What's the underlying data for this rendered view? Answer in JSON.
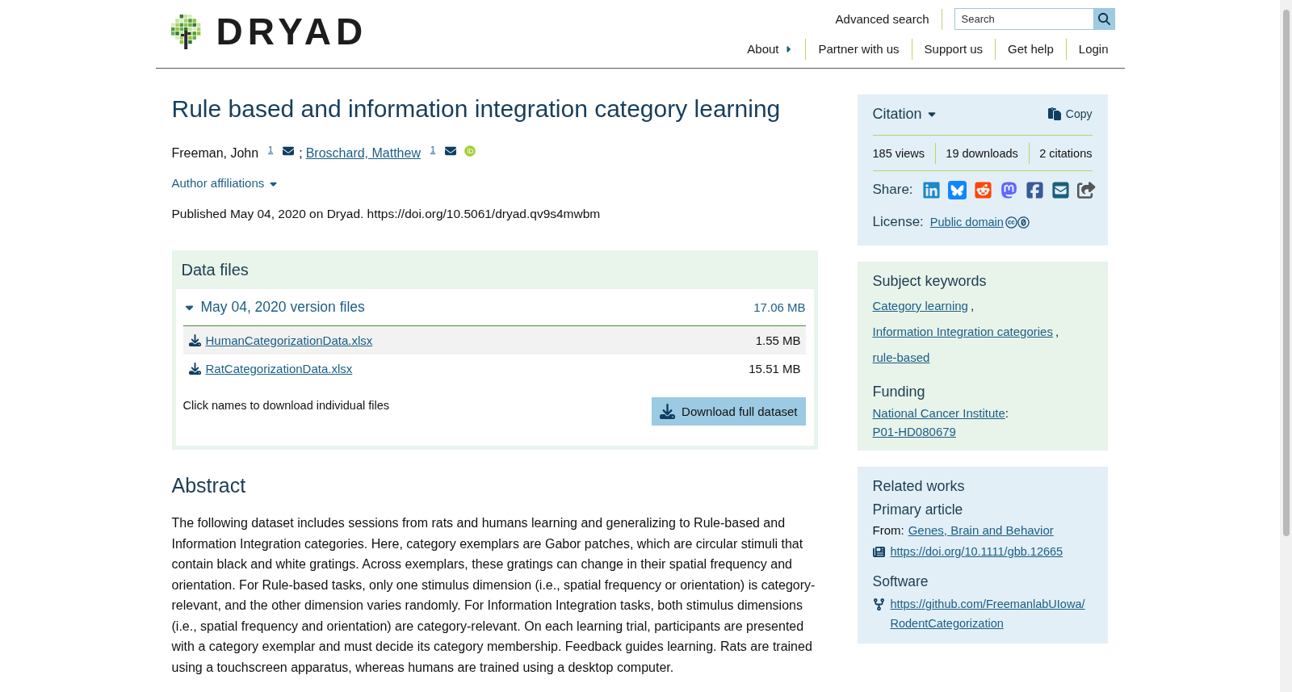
{
  "header": {
    "logo_text": "DRYAD",
    "advanced_search": "Advanced search",
    "search": {
      "placeholder": "Search"
    },
    "nav": [
      {
        "label": "About",
        "kind": "menu"
      },
      {
        "label": "Partner with us",
        "kind": "link"
      },
      {
        "label": "Support us",
        "kind": "link"
      },
      {
        "label": "Get help",
        "kind": "link"
      },
      {
        "label": "Login",
        "kind": "link"
      }
    ]
  },
  "dataset": {
    "title": "Rule based and information integration category learning",
    "authors": [
      {
        "name": "Freeman, John",
        "affiliation": "1",
        "linked": false,
        "email": true,
        "orcid": false
      },
      {
        "name": "Broschard, Matthew",
        "affiliation": "1",
        "linked": true,
        "email": true,
        "orcid": true
      }
    ],
    "author_separator": ";",
    "affiliations_toggle": "Author affiliations",
    "published": "Published May 04, 2020 on Dryad. https://doi.org/10.5061/dryad.qv9s4mwbm"
  },
  "data_files": {
    "heading": "Data files",
    "version": {
      "label": "May 04, 2020 version files",
      "size": "17.06 MB",
      "expanded": true
    },
    "files": [
      {
        "name": "HumanCategorizationData.xlsx",
        "size": "1.55 MB"
      },
      {
        "name": "RatCategorizationData.xlsx",
        "size": "15.51 MB"
      }
    ],
    "hint": "Click names to download individual files",
    "download_button": "Download full dataset"
  },
  "abstract": {
    "heading": "Abstract",
    "text": "The following dataset includes sessions from rats and humans learning and generalizing to Rule-based and Information Integration categories. Here, category exemplars are Gabor patches, which are circular stimuli that contain black and white gratings. Across exemplars, these gratings can change in their spatial frequency and orientation. For Rule-based tasks, only one stimulus dimension (i.e., spatial frequency or orientation) is category-relevant, and the other dimension varies randomly. For Information Integration tasks, both stimulus dimensions (i.e., spatial frequency and orientation) are category-relevant. On each learning trial, participants are presented with a category exemplar and must decide its category membership. Feedback guides learning. Rats are trained using a touchscreen apparatus, whereas humans are trained using a desktop computer."
  },
  "sidebar": {
    "citation": {
      "label": "Citation",
      "copy_button": "Copy",
      "stats": [
        "185 views",
        "19 downloads",
        "2 citations"
      ],
      "share_label": "Share:",
      "share_links": [
        {
          "kind": "linkedin",
          "color": "#1c87c9"
        },
        {
          "kind": "bluesky",
          "color": "#1185fe"
        },
        {
          "kind": "reddit",
          "color": "#ff4500"
        },
        {
          "kind": "mastodon",
          "color": "#6364ff"
        },
        {
          "kind": "facebook",
          "color": "#3b5998"
        },
        {
          "kind": "email",
          "color": "#1a5f7a"
        },
        {
          "kind": "share",
          "color": "#555555"
        }
      ],
      "license_label": "License:",
      "license": "Public domain"
    },
    "keywords": {
      "heading": "Subject keywords",
      "items": [
        "Category learning",
        "Information Integration categories",
        "rule-based"
      ],
      "separator": ","
    },
    "funding": {
      "heading": "Funding",
      "funder": "National Cancer Institute",
      "separator": ":",
      "grant": "P01-HD080679"
    },
    "related_works": {
      "heading": "Related works",
      "groups": [
        {
          "kind": "article",
          "heading": "Primary article",
          "source_label": "From:",
          "source": "Genes, Brain and Behavior",
          "link": "https://doi.org/10.1111/gbb.12665"
        },
        {
          "kind": "software",
          "heading": "Software",
          "link": "https://github.com/FreemanlabUIowa/RodentCategorization"
        }
      ]
    }
  }
}
